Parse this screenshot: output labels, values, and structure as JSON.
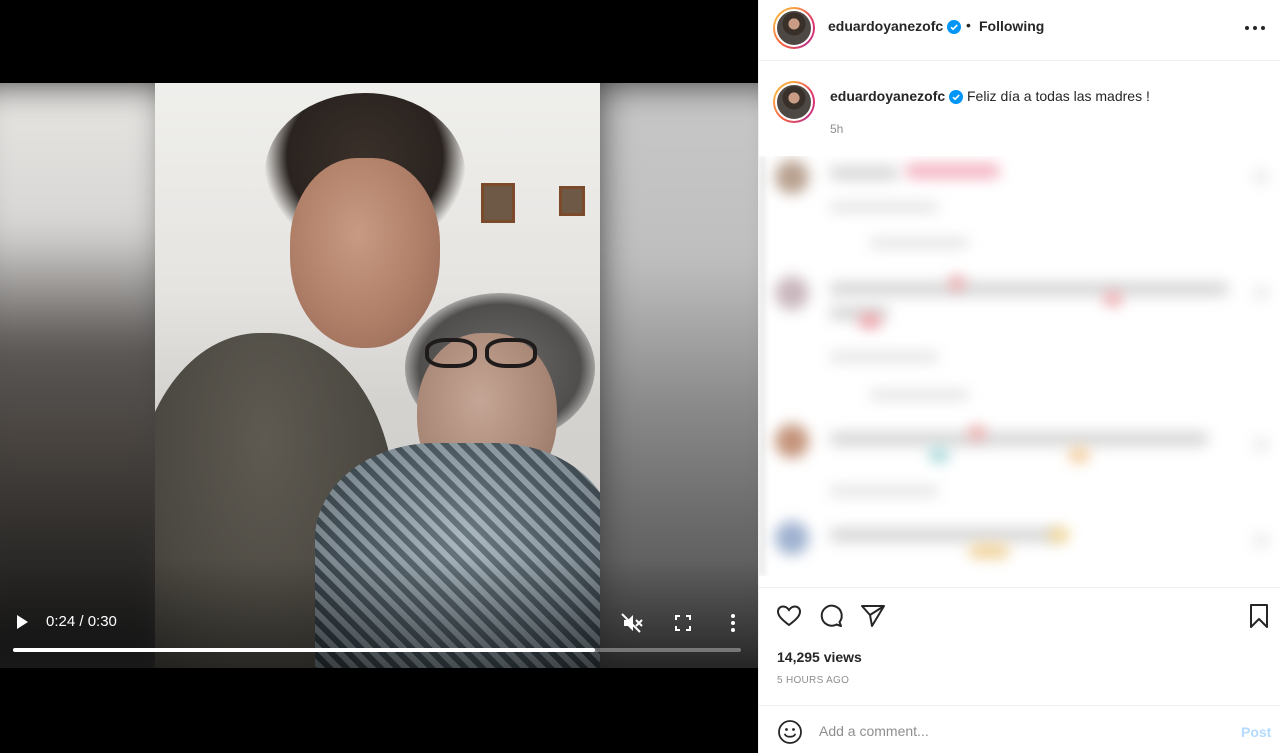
{
  "video": {
    "time_display": "0:24 / 0:30",
    "progress": 0.8,
    "icons": {
      "play": "play-icon",
      "mute": "muted-speaker-icon",
      "fullscreen": "fullscreen-icon",
      "more": "more-vertical-icon"
    }
  },
  "post": {
    "username": "eduardoyanezofc",
    "verified": true,
    "dot": "•",
    "following_label": "Following",
    "caption": {
      "username": "eduardoyanezofc",
      "text": "Feliz día a todas las madres !",
      "time": "5h"
    },
    "views": "14,295 views",
    "time_ago": "5 HOURS AGO",
    "comment_placeholder": "Add a comment...",
    "post_label": "Post",
    "icons": {
      "like": "heart-icon",
      "comment": "comment-bubble-icon",
      "share": "paper-plane-icon",
      "save": "bookmark-icon",
      "emoji": "emoji-icon",
      "options": "more-horizontal-icon",
      "verified": "verified-badge-icon"
    }
  },
  "colors": {
    "verified_blue": "#0095f6",
    "post_button_disabled": "#b3dbff",
    "secondary_text": "#8e8e8e"
  }
}
